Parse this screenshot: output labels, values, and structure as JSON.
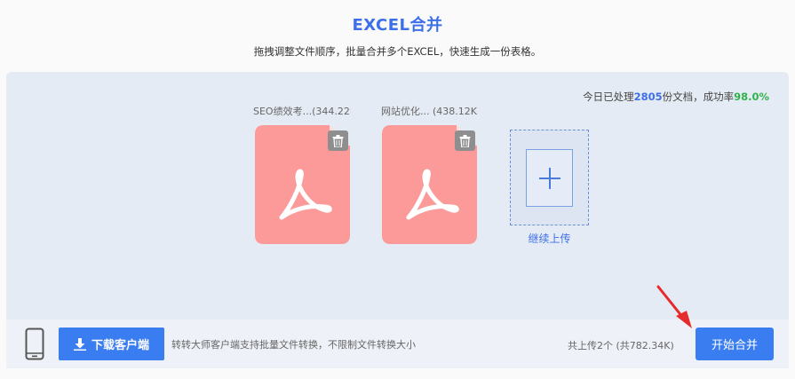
{
  "header": {
    "title": "EXCEL合并",
    "subtitle": "拖拽调整文件顺序，批量合并多个EXCEL，快速生成一份表格。"
  },
  "stats": {
    "prefix": "今日已处理",
    "count": "2805",
    "middle": "份文档，成功率",
    "rate": "98.0%"
  },
  "files": [
    {
      "name": "SEO绩效考...(344.22K",
      "icon": "pdf-file-icon"
    },
    {
      "name": "网站优化...  (438.12K",
      "icon": "pdf-file-icon"
    }
  ],
  "upload_more": {
    "label": "继续上传",
    "icon": "plus-icon"
  },
  "bottom": {
    "download_label": "下载客户端",
    "client_note": "转转大师客户端支持批量文件转换，不限制文件转换大小",
    "upload_count": "共上传2个 (共782.34K)",
    "merge_label": "开始合并"
  },
  "colors": {
    "accent": "#3d6fe8",
    "button": "#3a7df0",
    "success": "#2fb34a",
    "file_icon": "#fc9a9a",
    "arrow": "#e52b2b"
  }
}
